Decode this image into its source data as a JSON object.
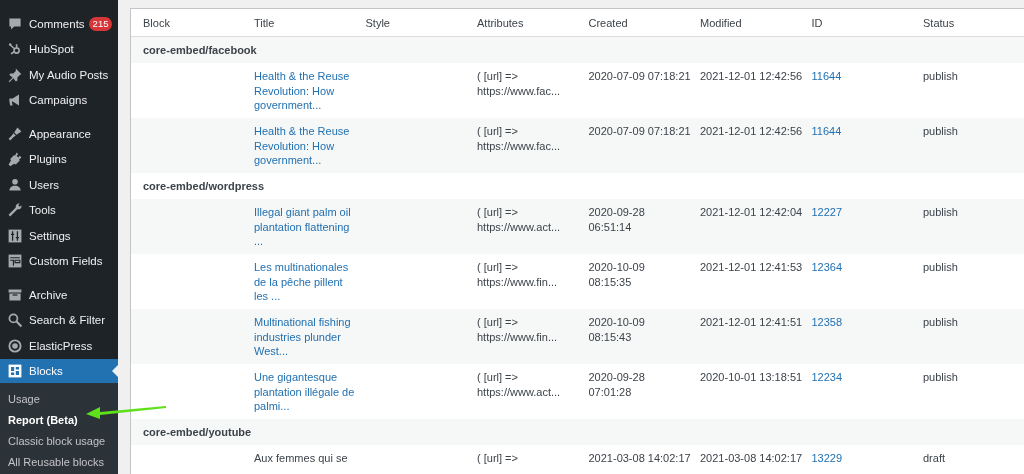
{
  "sidebar": {
    "groups": [
      {
        "items": [
          {
            "label": "Comments",
            "badge": "215",
            "selected": false
          },
          {
            "label": "HubSpot",
            "selected": false
          },
          {
            "label": "My Audio Posts",
            "selected": false
          },
          {
            "label": "Campaigns",
            "selected": false
          }
        ]
      },
      {
        "items": [
          {
            "label": "Appearance",
            "selected": false
          },
          {
            "label": "Plugins",
            "selected": false
          },
          {
            "label": "Users",
            "selected": false
          },
          {
            "label": "Tools",
            "selected": false
          },
          {
            "label": "Settings",
            "selected": false
          },
          {
            "label": "Custom Fields",
            "selected": false
          }
        ]
      },
      {
        "items": [
          {
            "label": "Archive",
            "selected": false
          },
          {
            "label": "Search & Filter",
            "selected": false
          },
          {
            "label": "ElasticPress",
            "selected": false
          },
          {
            "label": "Blocks",
            "selected": true
          }
        ]
      }
    ],
    "submenu": [
      {
        "label": "Usage",
        "selected": false
      },
      {
        "label": "Report (Beta)",
        "selected": true
      },
      {
        "label": "Classic block usage",
        "selected": false
      },
      {
        "label": "All Reusable blocks",
        "selected": false
      }
    ]
  },
  "table": {
    "columns": [
      "Block",
      "Title",
      "Style",
      "Attributes",
      "Created",
      "Modified",
      "ID",
      "Status"
    ],
    "groups": [
      {
        "block": "core-embed/facebook",
        "rows": [
          {
            "title": "Health & the Reuse\nRevolution: How\ngovernment...",
            "linked": true,
            "attributes": "( [url] =>\nhttps://www.fac...",
            "created": "2020-07-09 07:18:21",
            "modified": "2021-12-01 12:42:56",
            "id": "11644",
            "status": "publish"
          },
          {
            "title": "Health & the Reuse\nRevolution: How\ngovernment...",
            "linked": true,
            "attributes": "( [url] =>\nhttps://www.fac...",
            "created": "2020-07-09 07:18:21",
            "modified": "2021-12-01 12:42:56",
            "id": "11644",
            "status": "publish"
          }
        ]
      },
      {
        "block": "core-embed/wordpress",
        "rows": [
          {
            "title": "Illegal giant palm oil\nplantation flattening\n...",
            "linked": true,
            "attributes": "( [url] =>\nhttps://www.act...",
            "created": "2020-09-28\n06:51:14",
            "modified": "2021-12-01 12:42:04",
            "id": "12227",
            "status": "publish"
          },
          {
            "title": "Les multinationales\nde la pêche pillent\nles ...",
            "linked": true,
            "attributes": "( [url] =>\nhttps://www.fin...",
            "created": "2020-10-09\n08:15:35",
            "modified": "2021-12-01 12:41:53",
            "id": "12364",
            "status": "publish"
          },
          {
            "title": "Multinational fishing\nindustries plunder\nWest...",
            "linked": true,
            "attributes": "( [url] =>\nhttps://www.fin...",
            "created": "2020-10-09\n08:15:43",
            "modified": "2021-12-01 12:41:51",
            "id": "12358",
            "status": "publish"
          },
          {
            "title": "Une gigantesque\nplantation illégale de\npalmi...",
            "linked": true,
            "attributes": "( [url] =>\nhttps://www.act...",
            "created": "2020-09-28\n07:01:28",
            "modified": "2020-10-01 13:18:51",
            "id": "12234",
            "status": "publish"
          }
        ]
      },
      {
        "block": "core-embed/youtube",
        "rows": [
          {
            "title": "Aux femmes qui se",
            "linked": false,
            "attributes": "( [url] =>",
            "created": "2021-03-08 14:02:17",
            "modified": "2021-03-08 14:02:17",
            "id": "13229",
            "status": "draft"
          }
        ]
      }
    ]
  }
}
